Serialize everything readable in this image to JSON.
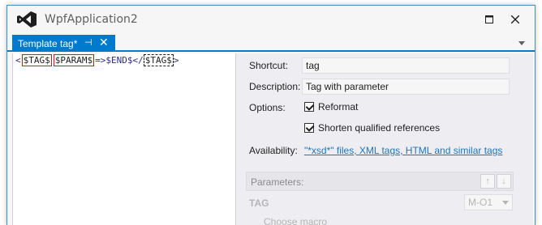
{
  "window": {
    "title": "WpfApplication2",
    "logo_icon": "visual-studio-logo",
    "maximize_icon": "maximize-icon",
    "close_icon": "close-icon"
  },
  "tab": {
    "label": "Template tag*",
    "pin_glyph": "⊣",
    "close_glyph": "✕"
  },
  "code": {
    "open_lt": "<",
    "tag_placeholder": "$TAG$",
    "space": " ",
    "param_placeholder": "$PARAM$",
    "middle": "=>",
    "end_token": "$END$",
    "close_lt": "</",
    "tag_mirror": "$TAG$",
    "close_gt": ">"
  },
  "properties": {
    "shortcut_label": "Shortcut:",
    "shortcut_value": "tag",
    "description_label": "Description:",
    "description_value": "Tag with parameter",
    "options_label": "Options:",
    "option_reformat": "Reformat",
    "option_shorten": "Shorten qualified references",
    "availability_label": "Availability:",
    "availability_link": "\"*xsd*\" files, XML tags, HTML and similar tags"
  },
  "parameters": {
    "header": "Parameters:",
    "up_glyph": "↑",
    "down_glyph": "↓",
    "name": "TAG",
    "select_value": "M-O1",
    "choose_macro": "Choose macro"
  },
  "colors": {
    "accent": "#007acc",
    "placeholder_border": "#e51400",
    "link": "#1e73b9"
  }
}
